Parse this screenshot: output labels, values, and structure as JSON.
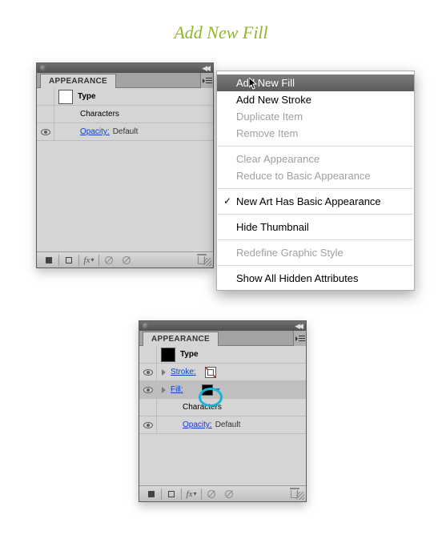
{
  "page_title": "Add New Fill",
  "panel1": {
    "tab": "APPEARANCE",
    "type_label": "Type",
    "characters_label": "Characters",
    "opacity_label": "Opacity:",
    "opacity_value": "Default"
  },
  "flyout": {
    "items": [
      {
        "label": "Add New Fill",
        "state": "highlighted"
      },
      {
        "label": "Add New Stroke",
        "state": "normal"
      },
      {
        "label": "Duplicate Item",
        "state": "disabled"
      },
      {
        "label": "Remove Item",
        "state": "disabled"
      },
      {
        "sep": true
      },
      {
        "label": "Clear Appearance",
        "state": "disabled"
      },
      {
        "label": "Reduce to Basic Appearance",
        "state": "disabled"
      },
      {
        "sep": true
      },
      {
        "label": "New Art Has Basic Appearance",
        "state": "checked"
      },
      {
        "sep": true
      },
      {
        "label": "Hide Thumbnail",
        "state": "normal"
      },
      {
        "sep": true
      },
      {
        "label": "Redefine Graphic Style",
        "state": "disabled"
      },
      {
        "sep": true
      },
      {
        "label": "Show All Hidden Attributes",
        "state": "normal"
      }
    ]
  },
  "panel2": {
    "tab": "APPEARANCE",
    "type_label": "Type",
    "stroke_label": "Stroke:",
    "fill_label": "Fill:",
    "characters_label": "Characters",
    "opacity_label": "Opacity:",
    "opacity_value": "Default"
  },
  "footer_icons": {
    "new_art": "new-art-icon",
    "clear": "clear-appearance-icon",
    "fx": "fx",
    "no1": "no-icon",
    "no2": "no-icon",
    "trash": "trash-icon"
  },
  "colors": {
    "title": "#8fb729",
    "annotation": "#19b5d6"
  }
}
